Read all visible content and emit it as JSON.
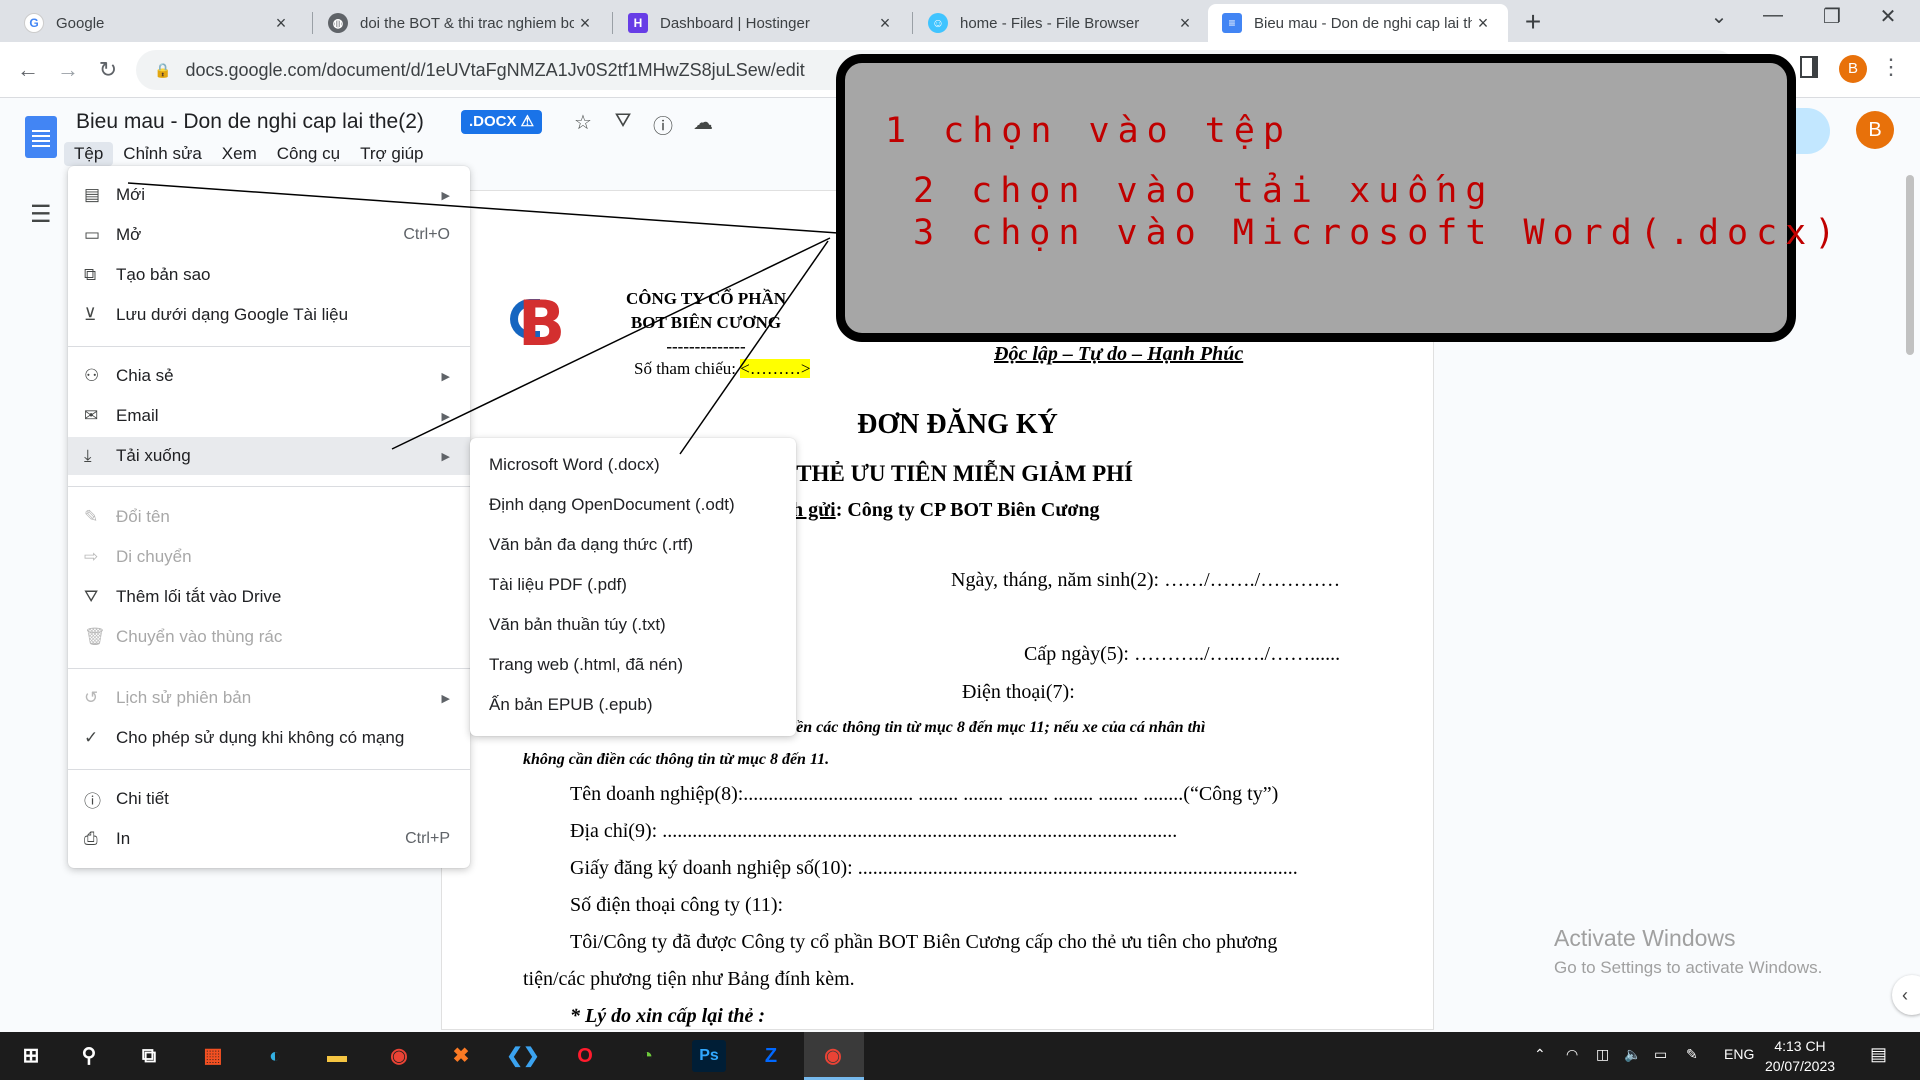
{
  "browser": {
    "tabs": [
      {
        "title": "Google",
        "icon": "google-icon"
      },
      {
        "title": "doi the BOT & thi trac nghiem bc",
        "icon": "globe-icon"
      },
      {
        "title": "Dashboard | Hostinger",
        "icon": "hostinger-icon"
      },
      {
        "title": "home - Files - File Browser",
        "icon": "filebrowser-icon"
      },
      {
        "title": "Bieu mau - Don de nghi cap lai th",
        "icon": "docs-icon",
        "active": true
      }
    ],
    "new_tab": "+",
    "url": "docs.google.com/document/d/1eUVtaFgNMZA1Jv0S2tf1MHwZS8juLSew/edit",
    "profile_initial": "B"
  },
  "docs": {
    "title": "Bieu mau - Don de nghi cap lai the(2)",
    "badge": ".DOCX ⚠",
    "menubar": [
      "Tệp",
      "Chỉnh sửa",
      "Xem",
      "Công cụ",
      "Trợ giúp"
    ],
    "avatar": "B"
  },
  "file_menu": {
    "items": [
      {
        "label": "Mới",
        "icon": "new-doc-icon",
        "glyph": "▤",
        "arrow": true
      },
      {
        "label": "Mở",
        "icon": "folder-icon",
        "glyph": "▭",
        "shortcut": "Ctrl+O"
      },
      {
        "label": "Tạo bản sao",
        "icon": "copy-icon",
        "glyph": "⧉"
      },
      {
        "label": "Lưu dưới dạng Google Tài liệu",
        "icon": "save-icon",
        "glyph": "⊻"
      },
      {
        "label": "Chia sẻ",
        "icon": "share-icon",
        "glyph": "⚇",
        "arrow": true
      },
      {
        "label": "Email",
        "icon": "email-icon",
        "glyph": "✉",
        "arrow": true
      },
      {
        "label": "Tải xuống",
        "icon": "download-icon",
        "glyph": "⤓",
        "arrow": true,
        "highlighted": true
      },
      {
        "label": "Đổi tên",
        "icon": "rename-icon",
        "glyph": "✎",
        "disabled": true
      },
      {
        "label": "Di chuyển",
        "icon": "move-icon",
        "glyph": "⇨",
        "disabled": true
      },
      {
        "label": "Thêm lối tắt vào Drive",
        "icon": "drive-shortcut-icon",
        "glyph": "⛛"
      },
      {
        "label": "Chuyển vào thùng rác",
        "icon": "trash-icon",
        "glyph": "🗑",
        "disabled": true
      },
      {
        "label": "Lịch sử phiên bản",
        "icon": "history-icon",
        "glyph": "↺",
        "arrow": true,
        "disabled": true
      },
      {
        "label": "Cho phép sử dụng khi không có mạng",
        "icon": "offline-icon",
        "glyph": "✓"
      },
      {
        "label": "Chi tiết",
        "icon": "info-icon",
        "glyph": "ⓘ"
      },
      {
        "label": "In",
        "icon": "print-icon",
        "glyph": "⎙",
        "shortcut": "Ctrl+P"
      }
    ]
  },
  "download_menu": {
    "items": [
      "Microsoft Word (.docx)",
      "Định dạng OpenDocument (.odt)",
      "Văn bản đa dạng thức (.rtf)",
      "Tài liệu PDF (.pdf)",
      "Văn bản thuần túy (.txt)",
      "Trang web (.html, đã nén)",
      "Ấn bản EPUB (.epub)"
    ]
  },
  "annotation": {
    "line1": "1 chọn vào tệp",
    "line2": "2 chọn vào tải xuống",
    "line3": "3 chọn vào Microsoft Word(.docx)"
  },
  "document": {
    "company_line1": "CÔNG TY CỔ PHẦN",
    "company_line2": "BOT BIÊN CƯƠNG",
    "company_dashes": "--------------",
    "ref_label": "Số tham chiếu: ",
    "ref_value": "<………>",
    "motto": "Độc lập – Tự do – Hạnh Phúc",
    "title": "ĐƠN ĐĂNG KÝ",
    "subtitle_partial": "I THẺ ƯU TIÊN MIỄN GIẢM PHÍ",
    "to_prefix": "h gửi",
    "to_rest": ": Công ty CP BOT Biên Cương",
    "dob": "Ngày, tháng, năm sinh(2): ……/……./…………",
    "issue_date": "Cấp ngày(5): ………../…..…./……......",
    "phone": "Điện thoại(7):",
    "note_line1": "Lưu ý: Nếu là xe của doanh nghiệp thì điền các thông tin từ mục 8 đến mục 11; nếu xe của cá nhân thì",
    "note_line2": "không cần điền các thông tin từ mục 8 đến 11.",
    "company_name": "Tên doanh nghiệp(8):.................................. ........ ........ ........ ........ ........ ........(“Công ty”)",
    "address": "Địa chỉ(9): .......................................................................................................",
    "reg_no": "Giấy đăng ký doanh nghiệp số(10): ........................................................................................",
    "company_phone": "Số điện thoại công ty (11):",
    "para1": "Tôi/Công ty đã được Công ty cổ phần BOT Biên Cương cấp cho thẻ ưu tiên cho phương",
    "para2": "tiện/các phương tiện như Bảng đính kèm.",
    "reason": "* Lý do xin cấp lại thẻ :"
  },
  "watermark": {
    "line1": "Activate Windows",
    "line2": "Go to Settings to activate Windows."
  },
  "taskbar": {
    "lang": "ENG",
    "time": "4:13 CH",
    "date": "20/07/2023"
  }
}
